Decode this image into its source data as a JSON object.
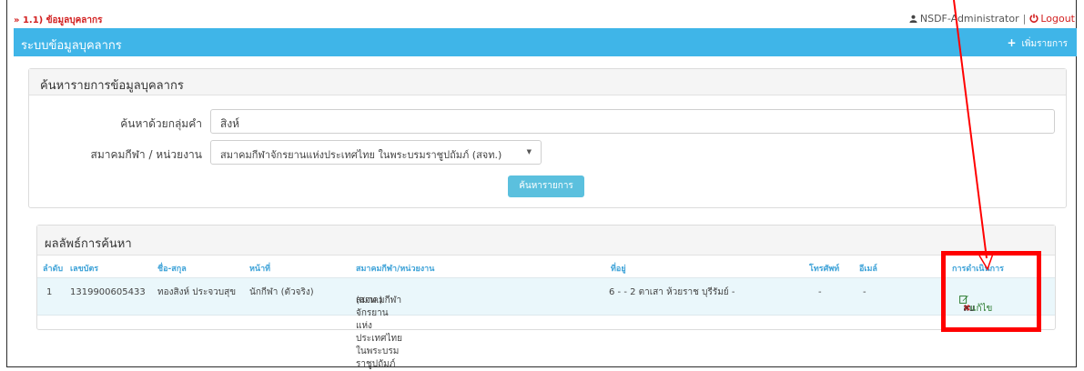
{
  "breadcrumb": "» 1.1) ข้อมูลบุคลากร",
  "user": {
    "name": "NSDF-Administrator",
    "separator": "|",
    "logout": "Logout"
  },
  "header": {
    "title": "ระบบข้อมูลบุคลากร",
    "add_label": "เพิ่มรายการ",
    "color": "#3fb5e8"
  },
  "search": {
    "panel_title": "ค้นหารายการข้อมูลบุคลากร",
    "keyword_label": "ค้นหาด้วยกลุ่มคำ",
    "keyword_value": "สิงห์",
    "association_label": "สมาคมกีฬา / หน่วยงาน",
    "association_value": "สมาคมกีฬาจักรยานแห่งประเทศไทย ในพระบรมราชูปถัมภ์ (สจท.)",
    "button_label": "ค้นหารายการ"
  },
  "results": {
    "panel_title": "ผลลัพธ์การค้นหา",
    "columns": [
      "ลำดับ",
      "เลขบัตร",
      "ชื่อ-สกุล",
      "หน้าที่",
      "สมาคมกีฬา/หน่วยงาน",
      "ที่อยู่",
      "โทรศัพท์",
      "อีเมล์",
      "การดำเนินการ"
    ],
    "rows": [
      {
        "no": "1",
        "id_card": "1319900605433",
        "name": "ทองสิงห์ ประจวบสุข",
        "role": "นักกีฬา (ตัวจริง)",
        "association_line1": "สมาคมกีฬาจักรยานแห่งประเทศไทย ในพระบรมราชูปถัมภ์",
        "association_line2": "(สจท.)",
        "address": "6 - - 2 ตาเสา ห้วยราช บุรีรัมย์ -",
        "phone": "-",
        "email": "-",
        "edit_label": "แก้ไข",
        "delete_label": "ลบ"
      }
    ]
  },
  "annotation_color": "#ff0000"
}
